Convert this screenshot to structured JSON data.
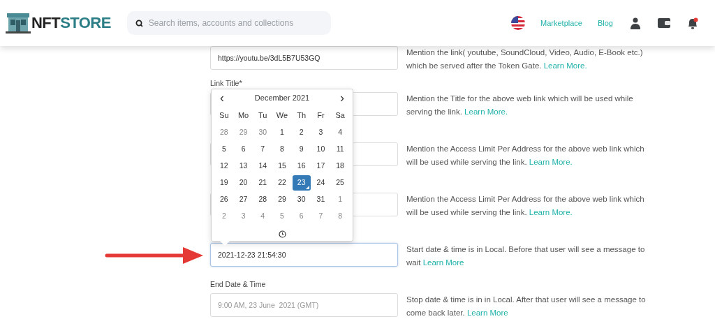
{
  "header": {
    "logo": {
      "first": "NFT",
      "second": "STORE"
    },
    "search": {
      "placeholder": "Search items, accounts and collections"
    },
    "nav": [
      "Marketplace",
      "Blog"
    ],
    "notification": true
  },
  "form": [
    {
      "value": "https://youtu.be/3dL5B7U53GQ",
      "focused": false,
      "description": "Mention the link( youtube, SoundCloud, Video, Audio, E-Book etc.) which be served after the Token Gate.",
      "link": "Learn More."
    },
    {
      "label": "Link Title*",
      "focused": false,
      "description": "Mention the Title for the above web link which will be used while serving the link.",
      "link": "Learn More."
    },
    {
      "focused": false,
      "description": "Mention the Access Limit Per Address for the above web link which will be used while serving the link.",
      "link": "Learn More."
    },
    {
      "focused": false,
      "description": "Mention the Access Limit Per Address for the above web link which will be used while serving the link.",
      "link": "Learn More."
    },
    {
      "value": "2021-12-23 21:54:30",
      "focused": true,
      "description": "Start date & time is in Local. Before that user will see a message to wait",
      "link": "Learn More"
    },
    {
      "label": "End Date & Time",
      "placeholder": "9:00 AM, 23 June  2021 (GMT)",
      "focused": false,
      "description": "Stop date & time is in in Local. After that user will see a message to come back later.",
      "link": "Learn More"
    }
  ],
  "calendar": {
    "prev": "‹",
    "month": "December 2021",
    "next": "›",
    "weekdays": [
      "Su",
      "Mo",
      "Tu",
      "We",
      "Th",
      "Fr",
      "Sa"
    ],
    "days": [
      [
        {
          "text": "28",
          "muted": true,
          "selected": false
        },
        {
          "text": "29",
          "muted": true,
          "selected": false
        },
        {
          "text": "30",
          "muted": true,
          "selected": false
        },
        {
          "text": "1",
          "muted": false,
          "selected": false
        },
        {
          "text": "2",
          "muted": false,
          "selected": false
        },
        {
          "text": "3",
          "muted": false,
          "selected": false
        },
        {
          "text": "4",
          "muted": false,
          "selected": false
        }
      ],
      [
        {
          "text": "5",
          "muted": false,
          "selected": false
        },
        {
          "text": "6",
          "muted": false,
          "selected": false
        },
        {
          "text": "7",
          "muted": false,
          "selected": false
        },
        {
          "text": "8",
          "muted": false,
          "selected": false
        },
        {
          "text": "9",
          "muted": false,
          "selected": false
        },
        {
          "text": "10",
          "muted": false,
          "selected": false
        },
        {
          "text": "11",
          "muted": false,
          "selected": false
        }
      ],
      [
        {
          "text": "12",
          "muted": false,
          "selected": false
        },
        {
          "text": "13",
          "muted": false,
          "selected": false
        },
        {
          "text": "14",
          "muted": false,
          "selected": false
        },
        {
          "text": "15",
          "muted": false,
          "selected": false
        },
        {
          "text": "16",
          "muted": false,
          "selected": false
        },
        {
          "text": "17",
          "muted": false,
          "selected": false
        },
        {
          "text": "18",
          "muted": false,
          "selected": false
        }
      ],
      [
        {
          "text": "19",
          "muted": false,
          "selected": false
        },
        {
          "text": "20",
          "muted": false,
          "selected": false
        },
        {
          "text": "21",
          "muted": false,
          "selected": false
        },
        {
          "text": "22",
          "muted": false,
          "selected": false
        },
        {
          "text": "23",
          "muted": false,
          "selected": true
        },
        {
          "text": "24",
          "muted": false,
          "selected": false
        },
        {
          "text": "25",
          "muted": false,
          "selected": false
        }
      ],
      [
        {
          "text": "26",
          "muted": false,
          "selected": false
        },
        {
          "text": "27",
          "muted": false,
          "selected": false
        },
        {
          "text": "28",
          "muted": false,
          "selected": false
        },
        {
          "text": "29",
          "muted": false,
          "selected": false
        },
        {
          "text": "30",
          "muted": false,
          "selected": false
        },
        {
          "text": "31",
          "muted": false,
          "selected": false
        },
        {
          "text": "1",
          "muted": true,
          "selected": false
        }
      ],
      [
        {
          "text": "2",
          "muted": true,
          "selected": false
        },
        {
          "text": "3",
          "muted": true,
          "selected": false
        },
        {
          "text": "4",
          "muted": true,
          "selected": false
        },
        {
          "text": "5",
          "muted": true,
          "selected": false
        },
        {
          "text": "6",
          "muted": true,
          "selected": false
        },
        {
          "text": "7",
          "muted": true,
          "selected": false
        },
        {
          "text": "8",
          "muted": true,
          "selected": false
        }
      ]
    ]
  }
}
